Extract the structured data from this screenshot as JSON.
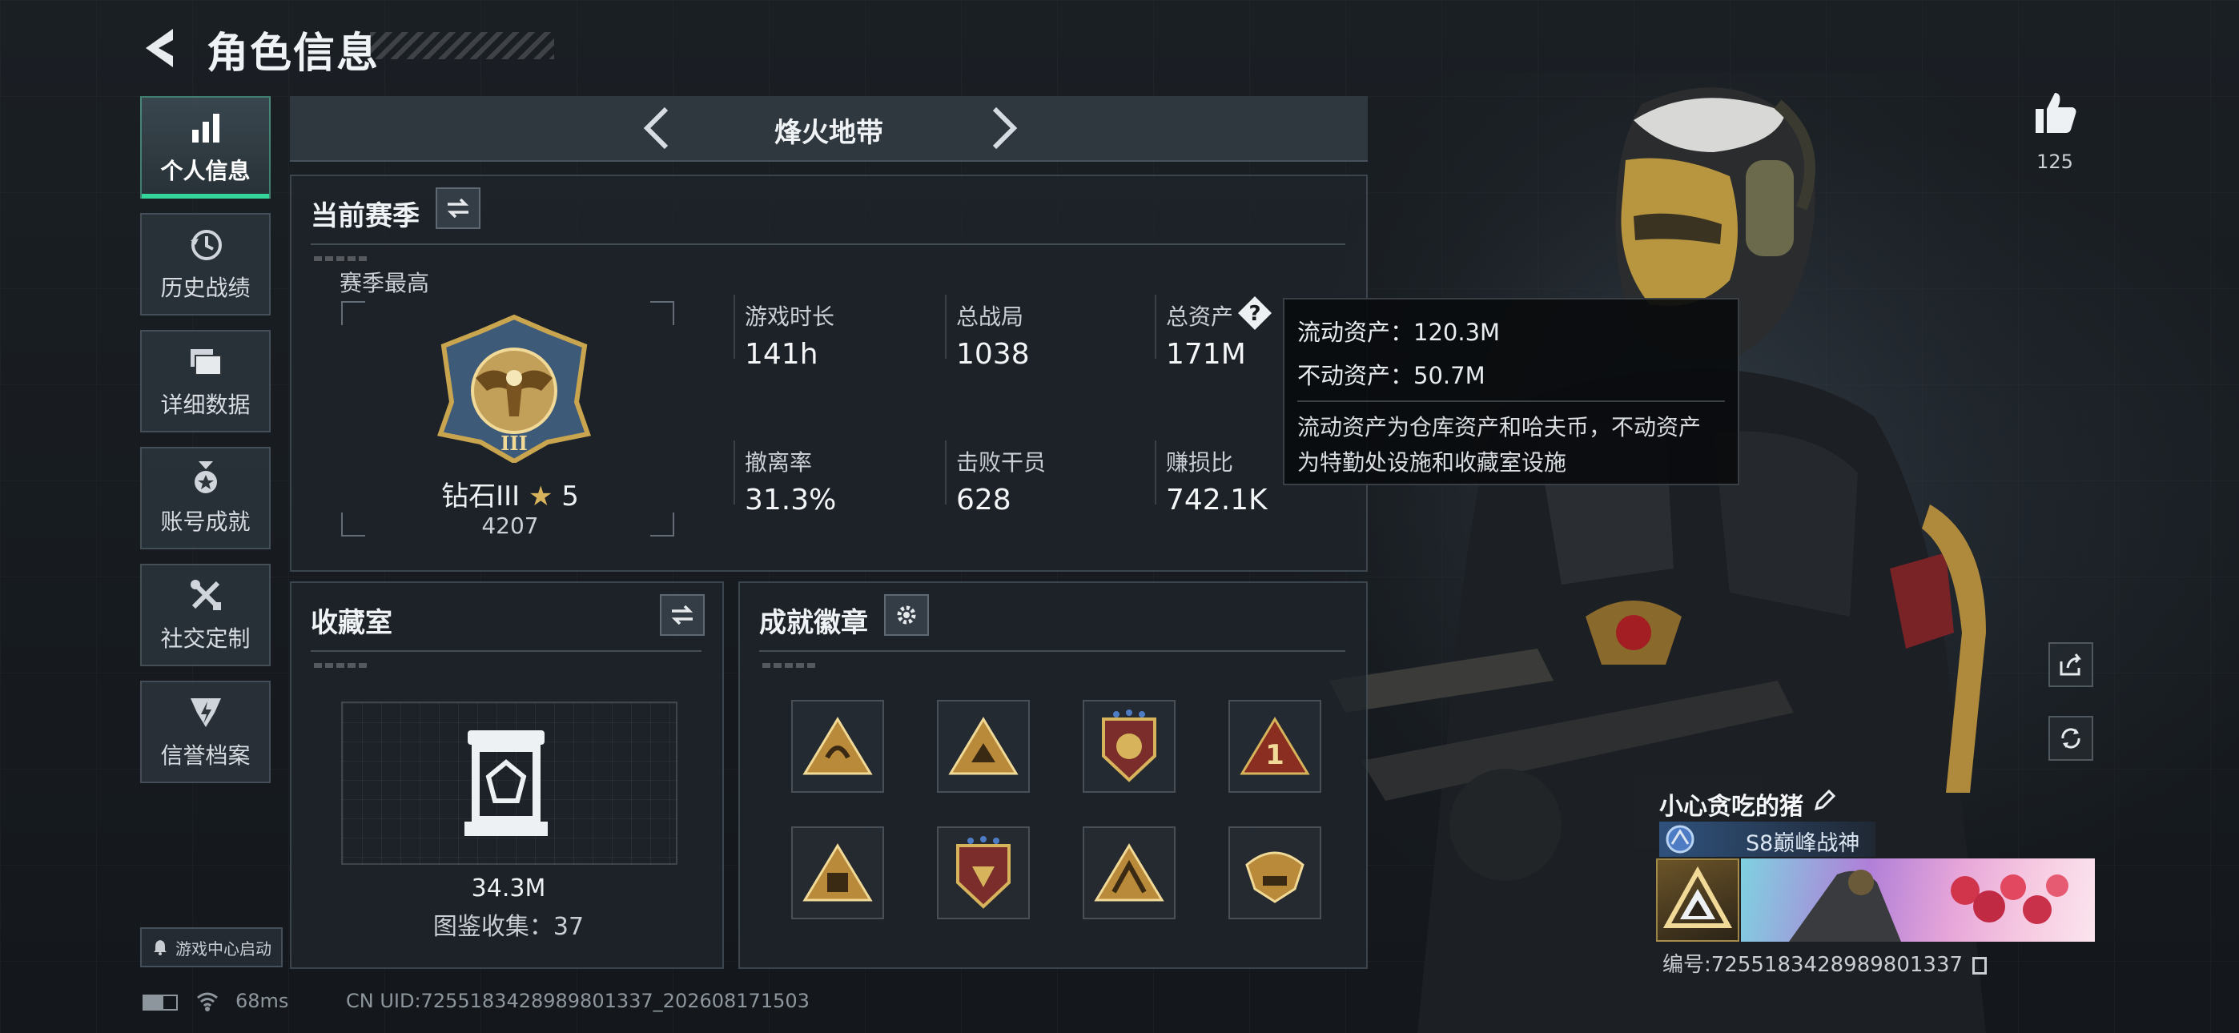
{
  "header": {
    "title": "角色信息"
  },
  "sidebar": {
    "items": [
      {
        "label": "个人信息",
        "icon": "bar-chart-icon",
        "active": true
      },
      {
        "label": "历史战绩",
        "icon": "history-icon"
      },
      {
        "label": "详细数据",
        "icon": "folder-icon"
      },
      {
        "label": "账号成就",
        "icon": "medal-icon"
      },
      {
        "label": "社交定制",
        "icon": "tools-icon"
      },
      {
        "label": "信誉档案",
        "icon": "shield-icon"
      }
    ],
    "game_center_label": "游戏中心启动"
  },
  "map_selector": {
    "current": "烽火地带"
  },
  "season": {
    "title": "当前赛季",
    "best_label": "赛季最高",
    "rank_name": "钻石III",
    "rank_stars": "5",
    "rank_points": "4207",
    "rank_numeral": "III",
    "stats": [
      {
        "label": "游戏时长",
        "value": "141h"
      },
      {
        "label": "总战局",
        "value": "1038"
      },
      {
        "label": "总资产",
        "value": "171M"
      },
      {
        "label": "撤离率",
        "value": "31.3%"
      },
      {
        "label": "击败干员",
        "value": "628"
      },
      {
        "label": "赚损比",
        "value": "742.1K"
      }
    ]
  },
  "tooltip": {
    "liquid": "流动资产：120.3M",
    "fixed": "不动资产：50.7M",
    "description_line1": "流动资产为仓库资产和哈夫币，不动资产",
    "description_line2": "为特勤处设施和收藏室设施"
  },
  "collection": {
    "title": "收藏室",
    "value": "34.3M",
    "catalog": "图鉴收集：37"
  },
  "achievements": {
    "title": "成就徽章",
    "badges": [
      "badge-1",
      "badge-2",
      "badge-3",
      "badge-4",
      "badge-5",
      "badge-6",
      "badge-7",
      "badge-8"
    ]
  },
  "player": {
    "likes": "125",
    "name": "小心贪吃的猪",
    "title": "S8巅峰战神",
    "id_line": "编号:7255183428989801337"
  },
  "status_bar": {
    "ping": "68ms",
    "uid": "CN UID:7255183428989801337_202608171503"
  },
  "colors": {
    "accent": "#34d59a",
    "gold": "#c9a54f",
    "panel_border": "#6e7d8c"
  }
}
